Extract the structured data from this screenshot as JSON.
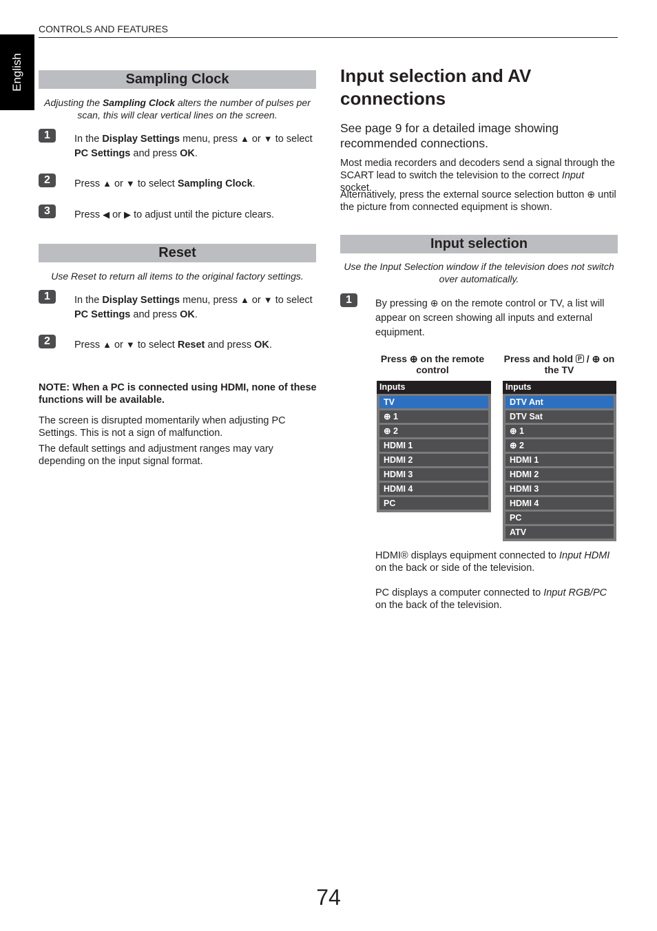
{
  "header": {
    "section": "CONTROLS AND FEATURES",
    "language_tab": "English"
  },
  "icons": {
    "up": "▲",
    "down": "▼",
    "left": "◀",
    "right": "▶",
    "input": "⊕",
    "p": "P"
  },
  "sampling_clock": {
    "title": "Sampling Clock",
    "intro": [
      {
        "t": "Adjusting the "
      },
      {
        "t": "Sampling Clock",
        "b": true
      },
      {
        "t": " alters the number of pulses per scan, this will clear vertical lines on the screen."
      }
    ],
    "steps": [
      {
        "num": "1",
        "text": [
          {
            "t": "In the "
          },
          {
            "t": "Display Settings",
            "b": true
          },
          {
            "t": " menu, press "
          },
          {
            "icon": "up"
          },
          {
            "t": " or "
          },
          {
            "icon": "down"
          },
          {
            "t": " to select "
          },
          {
            "t": "PC Settings",
            "b": true
          },
          {
            "t": " and press "
          },
          {
            "t": "OK",
            "b": true
          },
          {
            "t": "."
          }
        ]
      },
      {
        "num": "2",
        "text": [
          {
            "t": "Press "
          },
          {
            "icon": "up"
          },
          {
            "t": " or "
          },
          {
            "icon": "down"
          },
          {
            "t": " to select "
          },
          {
            "t": "Sampling Clock",
            "b": true
          },
          {
            "t": "."
          }
        ]
      },
      {
        "num": "3",
        "text": [
          {
            "t": "Press "
          },
          {
            "icon": "left"
          },
          {
            "t": " or "
          },
          {
            "icon": "right"
          },
          {
            "t": " to adjust until the picture clears."
          }
        ]
      }
    ]
  },
  "reset": {
    "title": "Reset",
    "intro": [
      {
        "t": "Use Reset to return all items to the original factory settings."
      }
    ],
    "steps": [
      {
        "num": "1",
        "text": [
          {
            "t": "In the "
          },
          {
            "t": "Display Settings",
            "b": true
          },
          {
            "t": " menu, press "
          },
          {
            "icon": "up"
          },
          {
            "t": " or "
          },
          {
            "icon": "down"
          },
          {
            "t": " to select "
          },
          {
            "t": "PC Settings",
            "b": true
          },
          {
            "t": " and press "
          },
          {
            "t": "OK",
            "b": true
          },
          {
            "t": "."
          }
        ]
      },
      {
        "num": "2",
        "text": [
          {
            "t": "Press "
          },
          {
            "icon": "up"
          },
          {
            "t": " or "
          },
          {
            "icon": "down"
          },
          {
            "t": " to select "
          },
          {
            "t": "Reset",
            "b": true
          },
          {
            "t": " and press "
          },
          {
            "t": "OK",
            "b": true
          },
          {
            "t": "."
          }
        ]
      }
    ]
  },
  "notes": {
    "note": "NOTE: When a PC is connected using HDMI, none of these functions will be available.",
    "para1": "The screen is disrupted momentarily when adjusting PC Settings. This is not a sign of malfunction.",
    "para2": "The default settings and adjustment ranges may vary depending on the input signal format."
  },
  "input_av": {
    "title": "Input selection and AV connections",
    "subtitle": "See page 9 for a detailed image showing recommended connections.",
    "para1": [
      {
        "t": "Most media recorders and decoders send a signal through the SCART lead to switch the television to the correct "
      },
      {
        "t": "Input",
        "i": true
      },
      {
        "t": " socket."
      }
    ],
    "para2": [
      {
        "t": "Alternatively, press the external source selection button "
      },
      {
        "icon": "input"
      },
      {
        "t": " until the picture from connected equipment is shown."
      }
    ]
  },
  "input_selection": {
    "title": "Input selection",
    "intro": [
      {
        "t": "Use the Input Selection window if the television does not switch over automatically."
      }
    ],
    "steps": [
      {
        "num": "1",
        "text": [
          {
            "t": "By pressing "
          },
          {
            "icon": "input"
          },
          {
            "t": " on the remote control or TV, a list will appear on screen showing all inputs and external equipment."
          }
        ]
      }
    ],
    "caption_remote": [
      {
        "t": "Press "
      },
      {
        "icon": "input"
      },
      {
        "t": " on the remote control"
      }
    ],
    "caption_tv": [
      {
        "t": "Press and hold "
      },
      {
        "icon": "p"
      },
      {
        "t": " / "
      },
      {
        "icon": "input"
      },
      {
        "t": " on the TV"
      }
    ],
    "menu_remote": {
      "header": "Inputs",
      "items": [
        "TV",
        "⊕ 1",
        "⊕ 2",
        "HDMI 1",
        "HDMI 2",
        "HDMI 3",
        "HDMI 4",
        "PC"
      ],
      "selected": 0
    },
    "menu_tv": {
      "header": "Inputs",
      "items": [
        "DTV Ant",
        "DTV Sat",
        "⊕ 1",
        "⊕ 2",
        "HDMI 1",
        "HDMI 2",
        "HDMI 3",
        "HDMI 4",
        "PC",
        "ATV"
      ],
      "selected": 0
    },
    "para_hdmi": [
      {
        "t": "HDMI® displays equipment connected to "
      },
      {
        "t": "Input HDMI",
        "i": true
      },
      {
        "t": " on the back or side of the television."
      }
    ],
    "para_pc": [
      {
        "t": "PC displays a computer connected to "
      },
      {
        "t": "Input RGB/PC",
        "i": true
      },
      {
        "t": " on the back of the television."
      }
    ]
  },
  "colors": {
    "bar": "#bcbdc0",
    "badge": "#4d4d4f",
    "menu_selected": "#2e70c0",
    "menu_item": "#4f4f51",
    "menu_header": "#231f20"
  },
  "page_number": "74"
}
